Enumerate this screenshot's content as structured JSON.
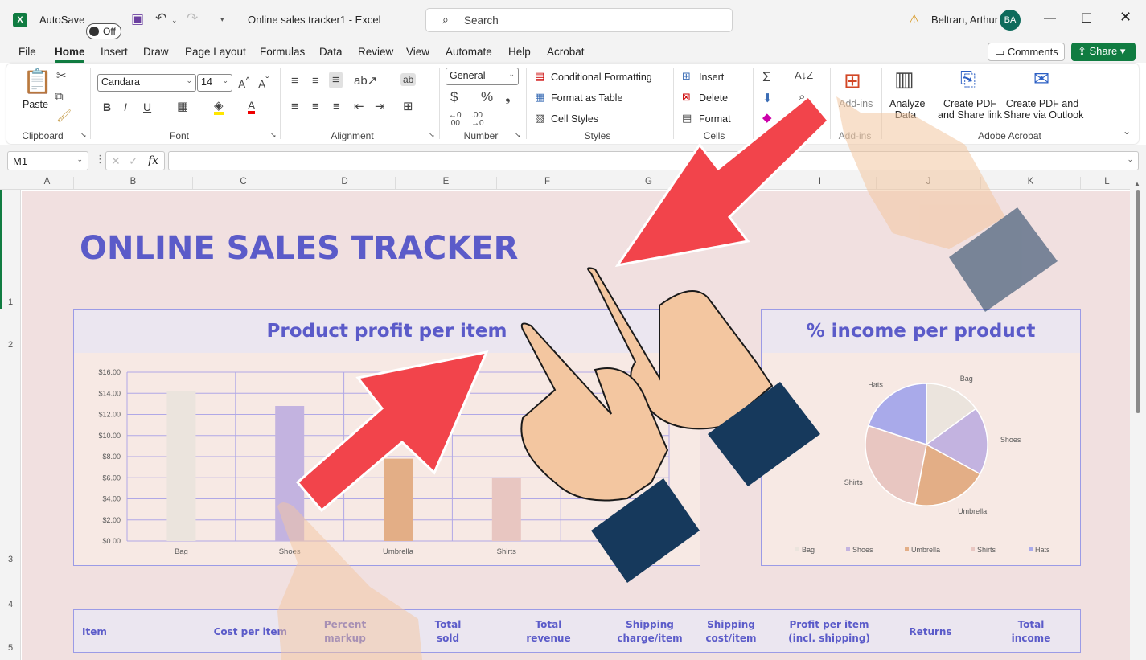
{
  "titlebar": {
    "autosave_label": "AutoSave",
    "autosave_state": "Off",
    "doc_title": "Online sales tracker1  -  Excel",
    "search_placeholder": "Search",
    "user_name": "Beltran, Arthur",
    "user_initials": "BA"
  },
  "menu": {
    "items": [
      "File",
      "Home",
      "Insert",
      "Draw",
      "Page Layout",
      "Formulas",
      "Data",
      "Review",
      "View",
      "Automate",
      "Help",
      "Acrobat"
    ],
    "active": "Home",
    "comments": "Comments",
    "share": "Share"
  },
  "ribbon": {
    "clipboard": {
      "paste": "Paste",
      "label": "Clipboard"
    },
    "font": {
      "name": "Candara",
      "size": "14",
      "label": "Font"
    },
    "alignment": {
      "label": "Alignment"
    },
    "number": {
      "format": "General",
      "label": "Number"
    },
    "styles": {
      "cond": "Conditional Formatting",
      "table": "Format as Table",
      "cell": "Cell Styles",
      "label": "Styles"
    },
    "cells": {
      "insert": "Insert",
      "delete": "Delete",
      "format": "Format",
      "label": "Cells"
    },
    "addins": {
      "btn": "Add-ins",
      "label": "Add-ins"
    },
    "analyze": {
      "line1": "Analyze",
      "line2": "Data"
    },
    "acrobat": {
      "pdf1a": "Create PDF",
      "pdf1b": "and Share link",
      "pdf2a": "Create PDF and",
      "pdf2b": "Share via Outlook",
      "label": "Adobe Acrobat"
    }
  },
  "formula_bar": {
    "name_box": "M1",
    "fx": "fx",
    "content": ""
  },
  "columns": [
    "A",
    "B",
    "C",
    "D",
    "E",
    "F",
    "G",
    "I",
    "J",
    "K",
    "L"
  ],
  "rows": [
    "1",
    "2",
    "3",
    "4",
    "5"
  ],
  "sheet": {
    "title": "ONLINE SALES TRACKER",
    "bar_title": "Product profit per item",
    "pie_title": "% income per product",
    "table_headers": [
      {
        "l1": "Item",
        "l2": ""
      },
      {
        "l1": "Cost per item",
        "l2": ""
      },
      {
        "l1": "Percent",
        "l2": "markup"
      },
      {
        "l1": "Total",
        "l2": "sold"
      },
      {
        "l1": "Total",
        "l2": "revenue"
      },
      {
        "l1": "Shipping",
        "l2": "charge/item"
      },
      {
        "l1": "Shipping",
        "l2": "cost/item"
      },
      {
        "l1": "Profit per item",
        "l2": "(incl. shipping)"
      },
      {
        "l1": "Returns",
        "l2": ""
      },
      {
        "l1": "Total",
        "l2": "income"
      }
    ]
  },
  "chart_data": [
    {
      "type": "bar",
      "title": "Product profit per item",
      "categories": [
        "Bag",
        "Shoes",
        "Umbrella",
        "Shirts"
      ],
      "values": [
        14.2,
        12.8,
        7.8,
        6.0
      ],
      "colors": [
        "#ebe4dd",
        "#c3b3e0",
        "#e3ae86",
        "#e8c6c1"
      ],
      "ylim": [
        0,
        16
      ],
      "yticks": [
        "$0.00",
        "$2.00",
        "$4.00",
        "$6.00",
        "$8.00",
        "$10.00",
        "$12.00",
        "$14.00",
        "$16.00"
      ],
      "grid": true
    },
    {
      "type": "pie",
      "title": "% income per product",
      "labels": [
        "Bag",
        "Shoes",
        "Umbrella",
        "Shirts",
        "Hats"
      ],
      "values": [
        15,
        18,
        20,
        27,
        20
      ],
      "colors": [
        "#ebe4dd",
        "#c3b3e0",
        "#e3ae86",
        "#e8c6c1",
        "#a9aaea"
      ],
      "legend": "bottom"
    }
  ],
  "overlay": {
    "arrow_color": "#f2444b",
    "skin": "#f3c6a0",
    "sleeve": "#16395c"
  }
}
